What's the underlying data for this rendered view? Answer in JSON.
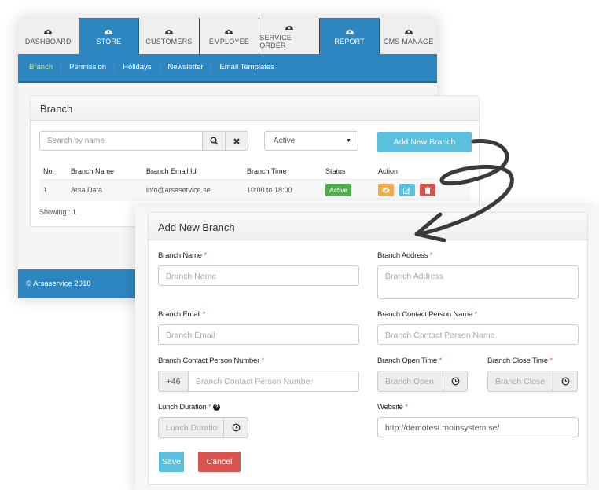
{
  "topnav": {
    "tabs": [
      {
        "label": "DASHBOARD",
        "icon": "dashboard-gauge-icon",
        "active": false
      },
      {
        "label": "STORE",
        "icon": "dashboard-gauge-icon",
        "active": true
      },
      {
        "label": "CUSTOMERS",
        "icon": "dashboard-gauge-icon",
        "active": false
      },
      {
        "label": "EMPLOYEE",
        "icon": "dashboard-gauge-icon",
        "active": false
      },
      {
        "label": "SERVICE ORDER",
        "icon": "dashboard-gauge-icon",
        "active": false
      },
      {
        "label": "REPORT",
        "icon": "dashboard-gauge-icon",
        "active": true
      },
      {
        "label": "CMS MANAGE",
        "icon": "dashboard-gauge-icon",
        "active": false
      }
    ]
  },
  "subnav": {
    "items": [
      {
        "label": "Branch",
        "active": true
      },
      {
        "label": "Permission",
        "active": false
      },
      {
        "label": "Holidays",
        "active": false
      },
      {
        "label": "Newsletter",
        "active": false
      },
      {
        "label": "Email Templates",
        "active": false
      }
    ]
  },
  "branch_panel": {
    "title": "Branch",
    "search_placeholder": "Search by name",
    "search_icon": "search-icon",
    "clear_icon": "close-icon",
    "status_filter": "Active",
    "add_button": "Add New Branch",
    "table": {
      "headers": [
        "No.",
        "Branch Name",
        "Branch Email Id",
        "Branch Time",
        "Status",
        "Action"
      ],
      "rows": [
        {
          "no": "1",
          "name": "Arsa Data",
          "email": "info@arsaservice.se",
          "time": "10:00 to 18:00",
          "status": "Active",
          "actions": [
            "hide-icon",
            "edit-icon",
            "delete-icon"
          ]
        }
      ]
    },
    "showing": "Showing : 1"
  },
  "footer": {
    "text": "© Arsaservice 2018"
  },
  "form": {
    "title": "Add New Branch",
    "required_mark": "*",
    "fields": {
      "branch_name": {
        "label": "Branch Name",
        "placeholder": "Branch Name"
      },
      "branch_address": {
        "label": "Branch Address",
        "placeholder": "Branch Address"
      },
      "branch_email": {
        "label": "Branch Email",
        "placeholder": "Branch Email"
      },
      "contact_name": {
        "label": "Branch Contact Person Name",
        "placeholder": "Branch Contact Person Name"
      },
      "contact_number": {
        "label": "Branch Contact Person Number",
        "prefix": "+46",
        "placeholder": "Branch Contact Person Number"
      },
      "open_time": {
        "label": "Branch Open Time",
        "placeholder": "Branch Open"
      },
      "close_time": {
        "label": "Branch Close Time",
        "placeholder": "Branch Close"
      },
      "lunch": {
        "label": "Lunch Duration",
        "placeholder": "Lunch Duratio",
        "help": "?"
      },
      "website": {
        "label": "Website",
        "value": "http://demotest.moinsystem.se/"
      }
    },
    "save": "Save",
    "cancel": "Cancel"
  },
  "colors": {
    "primary": "#2e86c1",
    "info": "#5bc0de",
    "danger": "#d9534f",
    "success": "#4cae4c",
    "warning": "#f0ad4e",
    "active_subnav": "#c6e96a"
  }
}
